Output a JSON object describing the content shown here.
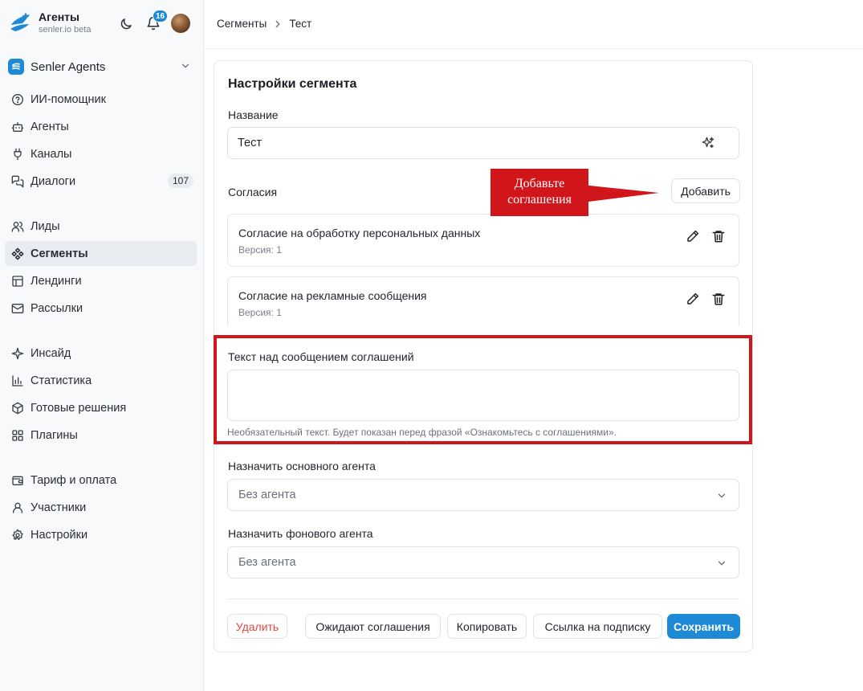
{
  "brand": {
    "title": "Агенты",
    "subtitle": "senler.io beta"
  },
  "header": {
    "notifications_count": "16"
  },
  "workspace": {
    "name": "Senler Agents"
  },
  "sidebar": {
    "groups": [
      {
        "items": [
          {
            "label": "ИИ-помощник",
            "icon": "help-circle-icon"
          },
          {
            "label": "Агенты",
            "icon": "robot-icon"
          },
          {
            "label": "Каналы",
            "icon": "plug-icon"
          },
          {
            "label": "Диалоги",
            "icon": "chat-icon",
            "count": "107"
          }
        ]
      },
      {
        "items": [
          {
            "label": "Лиды",
            "icon": "users-icon"
          },
          {
            "label": "Сегменты",
            "icon": "segments-icon",
            "active": true
          },
          {
            "label": "Лендинги",
            "icon": "layout-icon"
          },
          {
            "label": "Рассылки",
            "icon": "mail-icon"
          }
        ]
      },
      {
        "items": [
          {
            "label": "Инсайд",
            "icon": "sparkle-icon"
          },
          {
            "label": "Статистика",
            "icon": "bar-chart-icon"
          },
          {
            "label": "Готовые решения",
            "icon": "package-icon"
          },
          {
            "label": "Плагины",
            "icon": "puzzle-icon"
          }
        ]
      },
      {
        "items": [
          {
            "label": "Тариф и оплата",
            "icon": "wallet-icon"
          },
          {
            "label": "Участники",
            "icon": "user-icon"
          },
          {
            "label": "Настройки",
            "icon": "gear-icon"
          }
        ]
      }
    ]
  },
  "breadcrumb": {
    "parent": "Сегменты",
    "current": "Тест"
  },
  "card": {
    "title": "Настройки сегмента",
    "name_label": "Название",
    "name_value": "Тест",
    "consents_label": "Согласия",
    "add_button": "Добавить",
    "consents": [
      {
        "title": "Согласие на обработку персональных данных",
        "version": "Версия: 1"
      },
      {
        "title": "Согласие на рекламные сообщения",
        "version": "Версия: 1"
      }
    ],
    "text_label": "Текст над сообщением соглашений",
    "text_value": "",
    "text_hint": "Необязательный текст. Будет показан перед фразой «Ознакомьтесь с соглашениями».",
    "main_agent_label": "Назначить основного агента",
    "main_agent_value": "Без агента",
    "bg_agent_label": "Назначить фонового агента",
    "bg_agent_value": "Без агента",
    "buttons": {
      "delete": "Удалить",
      "awaiting": "Ожидают соглашения",
      "copy": "Копировать",
      "link": "Ссылка на подписку",
      "save": "Сохранить"
    }
  },
  "annotation": {
    "line1": "Добавьте",
    "line2": "соглашения"
  },
  "colors": {
    "accent": "#1e8ad6",
    "annotation": "#d0161b",
    "danger": "#e0463d"
  }
}
